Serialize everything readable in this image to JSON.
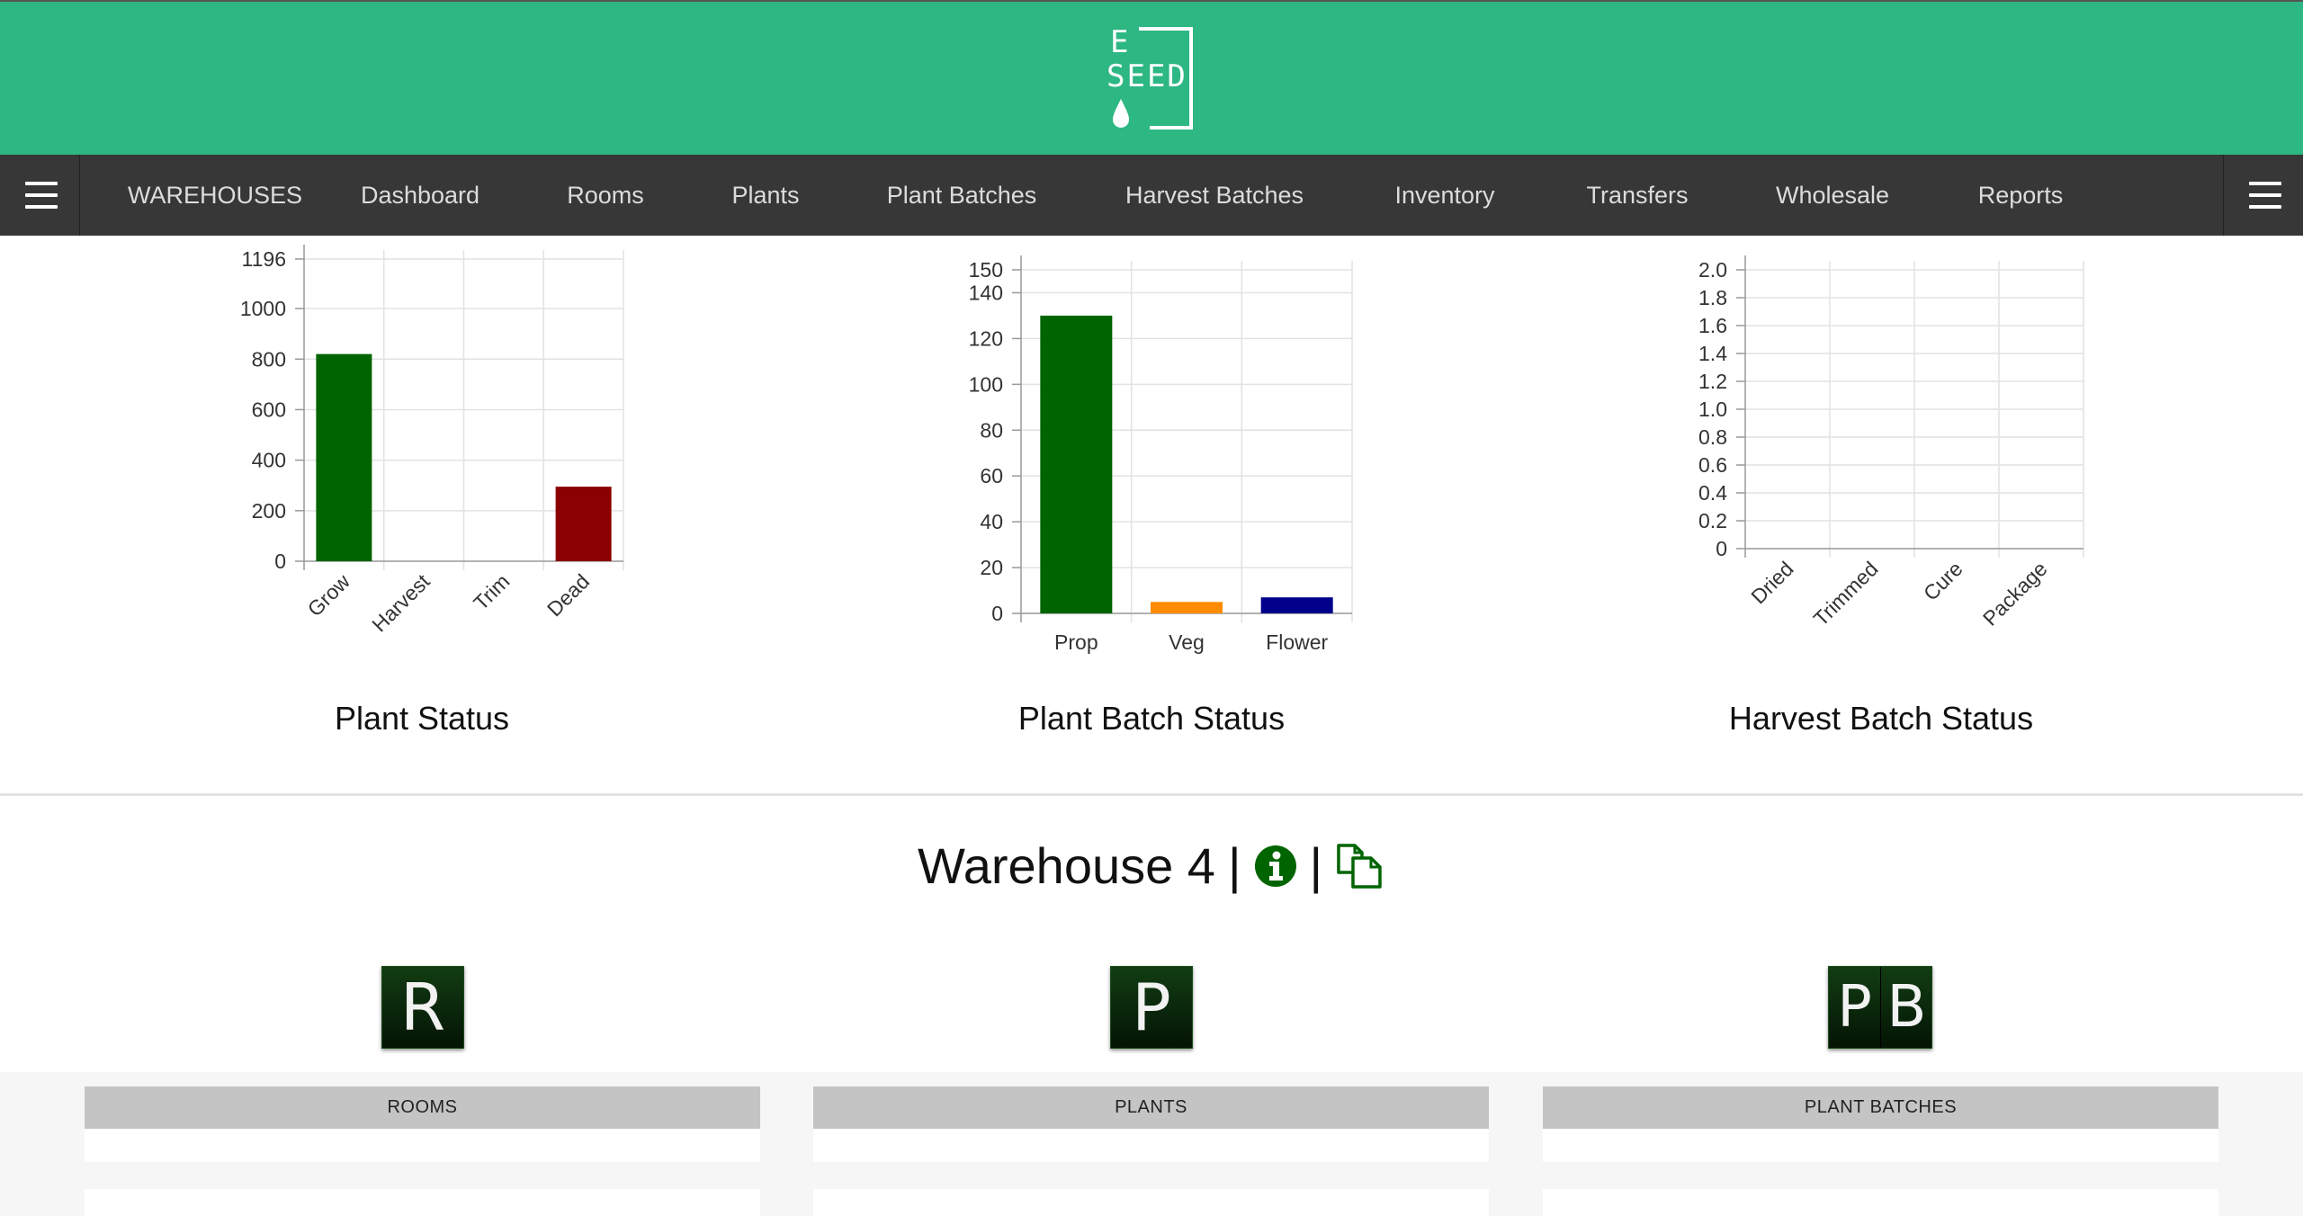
{
  "header": {
    "brand_color": "#2db782",
    "logo": {
      "line1": "E",
      "line2": "SEED",
      "icon": "seed-drop-icon"
    }
  },
  "nav": {
    "background": "#373737",
    "menu_icon": "hamburger-icon",
    "items": [
      {
        "label": "WAREHOUSES"
      },
      {
        "label": "Dashboard"
      },
      {
        "label": "Rooms"
      },
      {
        "label": "Plants"
      },
      {
        "label": "Plant Batches"
      },
      {
        "label": "Harvest Batches"
      },
      {
        "label": "Inventory"
      },
      {
        "label": "Transfers"
      },
      {
        "label": "Wholesale"
      },
      {
        "label": "Reports"
      }
    ]
  },
  "charts": {
    "titles": [
      "Plant Status",
      "Plant Batch Status",
      "Harvest Batch Status"
    ]
  },
  "chart_data": [
    {
      "type": "bar",
      "title": "Plant Status",
      "categories": [
        "Grow",
        "Harvest",
        "Trim",
        "Dead"
      ],
      "values": [
        820,
        0,
        0,
        295
      ],
      "colors": [
        "#006400",
        "#006400",
        "#006400",
        "#8b0000"
      ],
      "ylim": [
        0,
        1196
      ],
      "yticks": [
        "0",
        "200",
        "400",
        "600",
        "800",
        "1000",
        "1196"
      ],
      "xlabel_rotation": "rotated",
      "grid": true
    },
    {
      "type": "bar",
      "title": "Plant Batch Status",
      "categories": [
        "Prop",
        "Veg",
        "Flower"
      ],
      "values": [
        130,
        5,
        7
      ],
      "colors": [
        "#006400",
        "#ff8c00",
        "#00008b"
      ],
      "ylim": [
        0,
        150
      ],
      "yticks": [
        "0",
        "20",
        "40",
        "60",
        "80",
        "100",
        "120",
        "140",
        "150"
      ],
      "xlabel_rotation": "horizontal",
      "grid": true
    },
    {
      "type": "bar",
      "title": "Harvest Batch Status",
      "categories": [
        "Dried",
        "Trimmed",
        "Cure",
        "Package"
      ],
      "values": [
        0,
        0,
        0,
        0
      ],
      "colors": [
        "#006400",
        "#006400",
        "#006400",
        "#006400"
      ],
      "ylim": [
        0,
        2.0
      ],
      "yticks": [
        "0",
        "0.2",
        "0.4",
        "0.6",
        "0.8",
        "1.0",
        "1.2",
        "1.4",
        "1.6",
        "1.8",
        "2.0"
      ],
      "xlabel_rotation": "rotated",
      "grid": true
    }
  ],
  "warehouse": {
    "name": "Warehouse 4",
    "separator": "|",
    "info_icon": "info-circle-icon",
    "copy_icon": "copy-documents-icon",
    "accent": "#006400"
  },
  "tiles": [
    {
      "letters": [
        "R"
      ],
      "label": "ROOMS"
    },
    {
      "letters": [
        "P"
      ],
      "label": "PLANTS"
    },
    {
      "letters": [
        "P",
        "B"
      ],
      "label": "PLANT BATCHES"
    }
  ]
}
